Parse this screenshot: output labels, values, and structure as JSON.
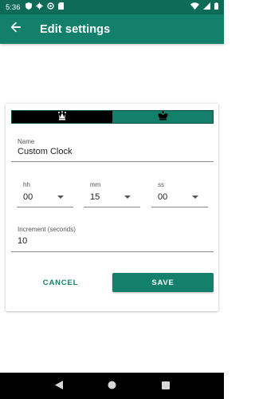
{
  "status_bar": {
    "time": "5:36",
    "left_icons": [
      "shield-icon",
      "gear-icon",
      "sync-icon",
      "sd-card-icon"
    ],
    "right_icons": [
      "wifi-icon",
      "signal-icon",
      "battery-icon"
    ]
  },
  "app_bar": {
    "title": "Edit settings",
    "back_icon": "arrow-back-icon"
  },
  "side_toggle": {
    "white_icon": "white-queen-icon",
    "black_icon": "black-king-icon"
  },
  "name_field": {
    "label": "Name",
    "value": "Custom Clock"
  },
  "time_fields": {
    "hh": {
      "label": "hh",
      "value": "00"
    },
    "mm": {
      "label": "mm",
      "value": "15"
    },
    "ss": {
      "label": "ss",
      "value": "00"
    }
  },
  "increment_field": {
    "label": "Increment (seconds)",
    "value": "10"
  },
  "buttons": {
    "cancel": "CANCEL",
    "save": "SAVE"
  },
  "colors": {
    "status_bar": "#0d6b58",
    "primary": "#12806a",
    "black_segment": "#000000"
  },
  "nav_bar": {
    "icons": [
      "nav-back-icon",
      "nav-home-icon",
      "nav-recents-icon"
    ]
  }
}
